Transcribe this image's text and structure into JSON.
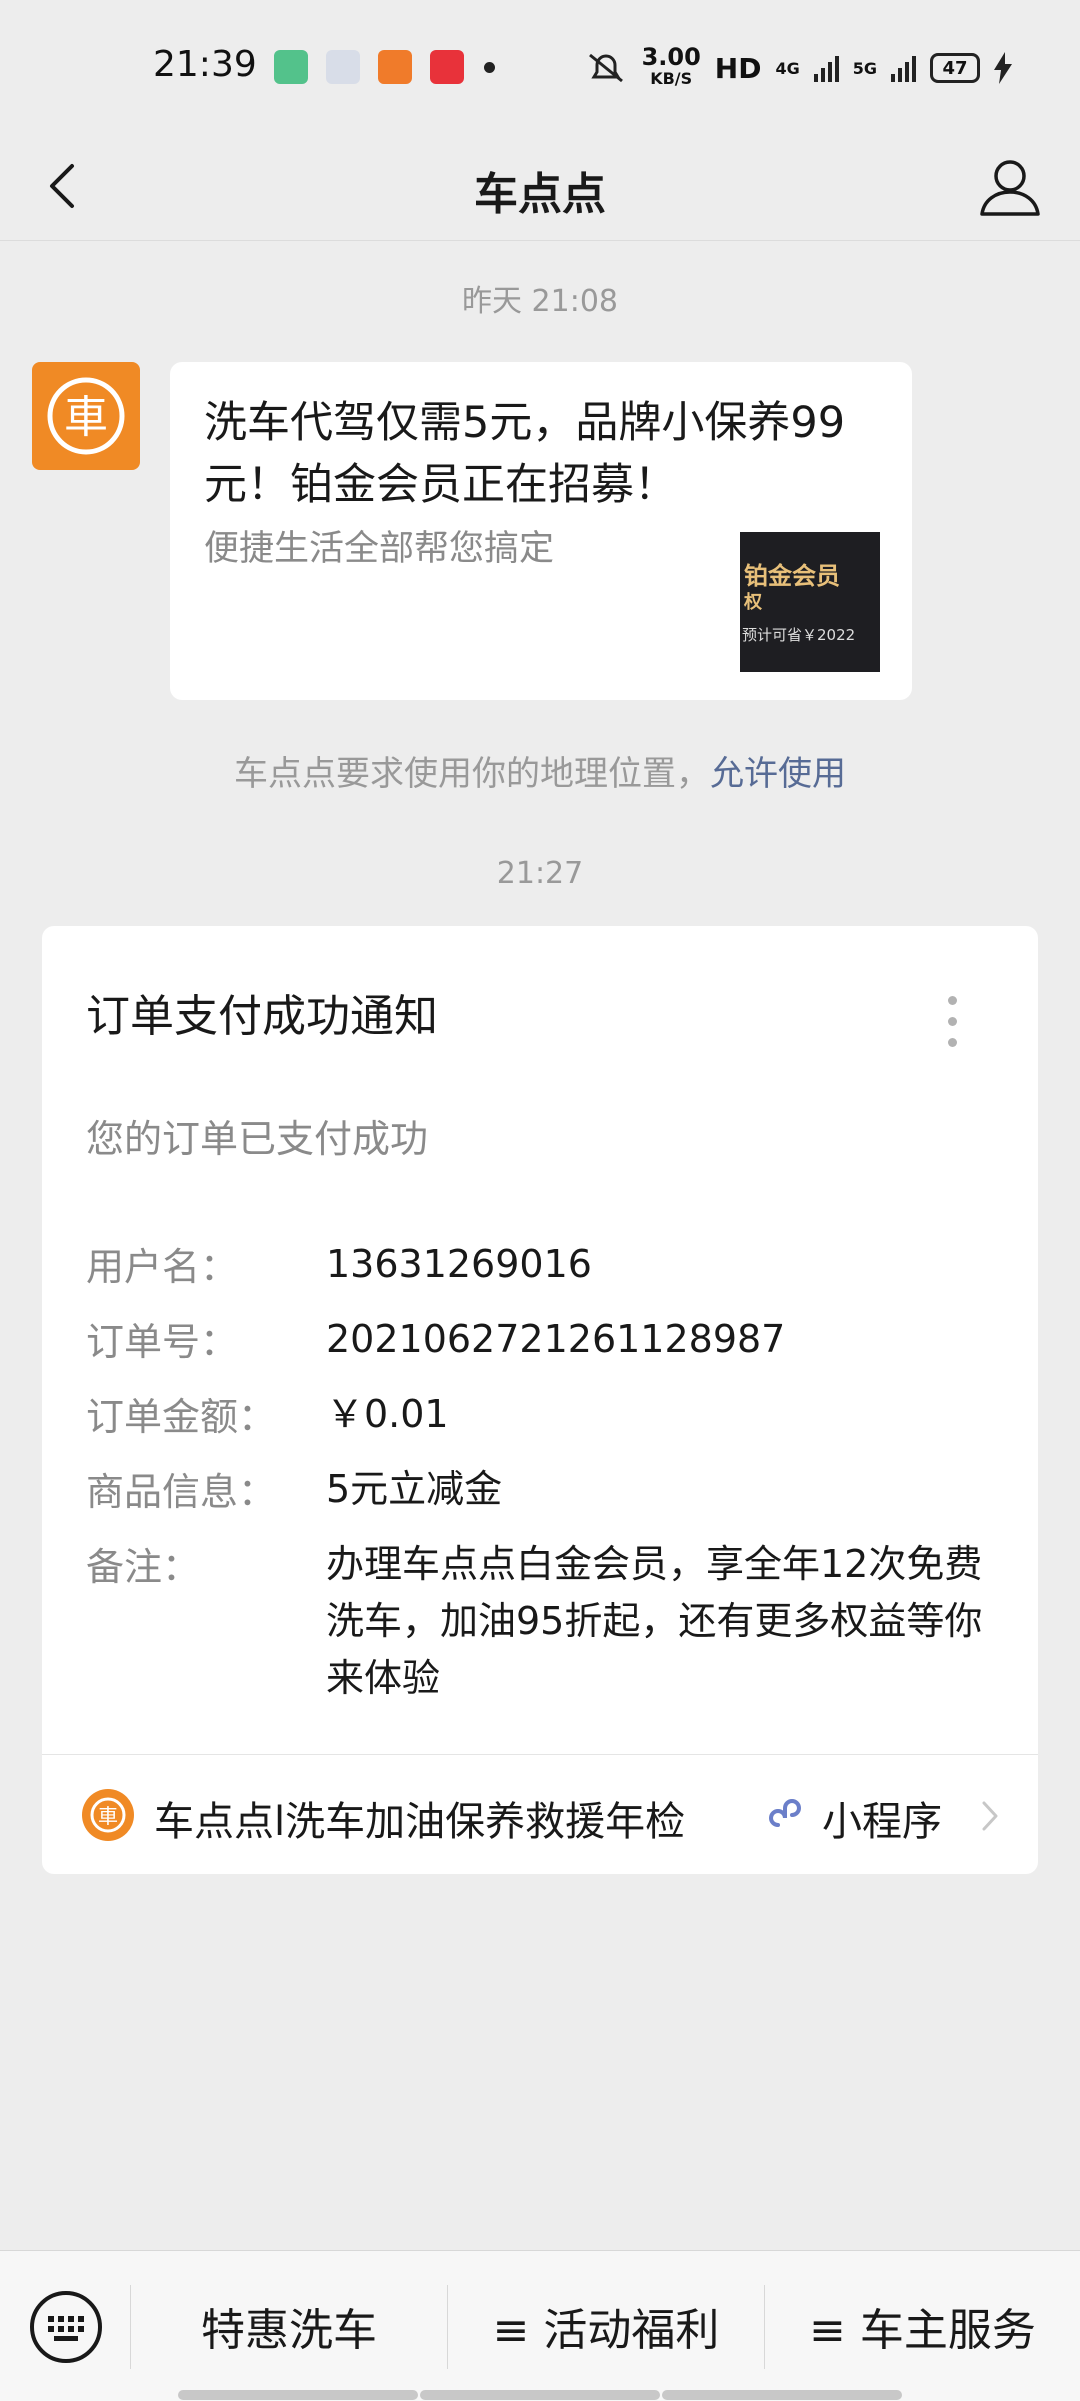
{
  "status_bar": {
    "time": "21:39",
    "speed_value": "3.00",
    "speed_unit": "KB/S",
    "hd": "HD",
    "net_4g": "4G",
    "net_5g": "5G",
    "battery": "47"
  },
  "navbar": {
    "title": "车点点",
    "back_icon": "chevron-left-icon",
    "profile_icon": "user-icon"
  },
  "chat": {
    "timestamp1": "昨天 21:08",
    "bubble": {
      "title": "洗车代驾仅需5元，品牌小保养99元！铂金会员正在招募！",
      "desc": "便捷生活全部帮您搞定",
      "thumb_text1": "铂金会员",
      "thumb_text2": "权",
      "thumb_text3": "预计可省￥2022"
    },
    "location_note": "车点点要求使用你的地理位置，",
    "location_link": "允许使用",
    "timestamp2": "21:27"
  },
  "card": {
    "title": "订单支付成功通知",
    "subtitle": "您的订单已支付成功",
    "rows": [
      {
        "key": "用户名：",
        "value": "13631269016"
      },
      {
        "key": "订单号：",
        "value": "202106272126112898​7"
      },
      {
        "key": "订单金额：",
        "value": "￥0.01"
      },
      {
        "key": "商品信息：",
        "value": "5元立减金"
      },
      {
        "key": "备注：",
        "value": "办理车点点白金会员，享全年12次免费洗车，加油95折起，还有更多权益等你来体验"
      }
    ],
    "footer_name": "车点点l洗车加油保养救援年检",
    "footer_tag": "小程序"
  },
  "bottom_menu": {
    "items": [
      "特惠洗车",
      "≡ 活动福利",
      "≡ 车主服务"
    ]
  },
  "colors": {
    "brand_orange": "#f08a25",
    "link_blue": "#576b95",
    "bg": "#ededed"
  }
}
